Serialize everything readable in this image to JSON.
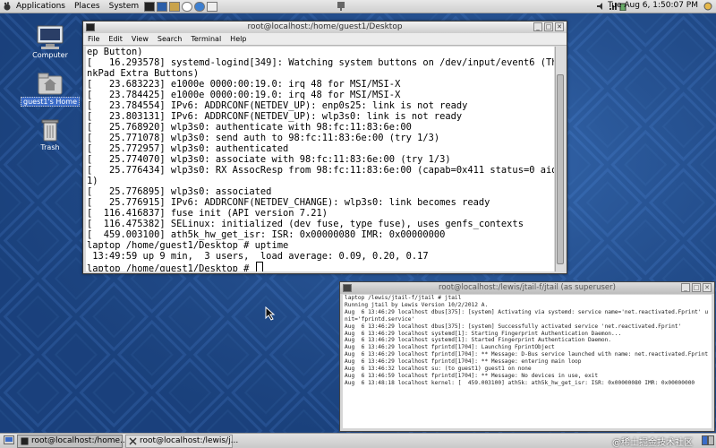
{
  "top_panel": {
    "menus": [
      "Applications",
      "Places",
      "System"
    ],
    "clock": "Tue Aug  6,  1:50:07 PM"
  },
  "desktop_icons": [
    {
      "label": "Computer",
      "icon": "computer-icon"
    },
    {
      "label": "guest1's Home",
      "icon": "home-folder-icon"
    },
    {
      "label": "Trash",
      "icon": "trash-icon"
    }
  ],
  "terminal1": {
    "title": "root@localhost:/home/guest1/Desktop",
    "menu": [
      "File",
      "Edit",
      "View",
      "Search",
      "Terminal",
      "Help"
    ],
    "lines": [
      "ep Button)",
      "[   16.293578] systemd-logind[349]: Watching system buttons on /dev/input/event6 (Thi",
      "nkPad Extra Buttons)",
      "[   23.683223] e1000e 0000:00:19.0: irq 48 for MSI/MSI-X",
      "[   23.784425] e1000e 0000:00:19.0: irq 48 for MSI/MSI-X",
      "[   23.784554] IPv6: ADDRCONF(NETDEV_UP): enp0s25: link is not ready",
      "[   23.803131] IPv6: ADDRCONF(NETDEV_UP): wlp3s0: link is not ready",
      "[   25.768920] wlp3s0: authenticate with 98:fc:11:83:6e:00",
      "[   25.771078] wlp3s0: send auth to 98:fc:11:83:6e:00 (try 1/3)",
      "[   25.772957] wlp3s0: authenticated",
      "[   25.774070] wlp3s0: associate with 98:fc:11:83:6e:00 (try 1/3)",
      "[   25.776434] wlp3s0: RX AssocResp from 98:fc:11:83:6e:00 (capab=0x411 status=0 aid=",
      "1)",
      "[   25.776895] wlp3s0: associated",
      "[   25.776915] IPv6: ADDRCONF(NETDEV_CHANGE): wlp3s0: link becomes ready",
      "[  116.416837] fuse init (API version 7.21)",
      "[  116.475382] SELinux: initialized (dev fuse, type fuse), uses genfs_contexts",
      "[  459.003100] ath5k_hw_get_isr: ISR: 0x00000080 IMR: 0x00000000",
      "laptop /home/guest1/Desktop # uptime",
      " 13:49:59 up 9 min,  3 users,  load average: 0.09, 0.20, 0.17"
    ],
    "prompt": "laptop /home/guest1/Desktop # "
  },
  "terminal2": {
    "title": "root@localhost:/lewis/jtail-f/jtail (as superuser)",
    "lines": [
      "laptop /lewis/jtail-f/jtail # jtail",
      "Running jtail by Lewis Version 10/2/2012 A.",
      "Aug  6 13:46:29 localhost dbus[375]: [system] Activating via systemd: service name='net.reactivated.Fprint' u",
      "nit='fprintd.service'",
      "Aug  6 13:46:29 localhost dbus[375]: [system] Successfully activated service 'net.reactivated.Fprint'",
      "Aug  6 13:46:29 localhost systemd[1]: Starting Fingerprint Authentication Daemon...",
      "Aug  6 13:46:29 localhost systemd[1]: Started Fingerprint Authentication Daemon.",
      "Aug  6 13:46:29 localhost fprintd[1704]: Launching FprintObject",
      "Aug  6 13:46:29 localhost fprintd[1704]: ** Message: D-Bus service launched with name: net.reactivated.Fprint",
      "Aug  6 13:46:29 localhost fprintd[1704]: ** Message: entering main loop",
      "Aug  6 13:46:32 localhost su: (to guest1) guest1 on none",
      "Aug  6 13:46:59 localhost fprintd[1704]: ** Message: No devices in use, exit",
      "Aug  6 13:48:18 localhost kernel: [  459.003100] ath5k: ath5k_hw_get_isr: ISR: 0x00000080 IMR: 0x00000000"
    ]
  },
  "taskbar": {
    "items": [
      {
        "label": "root@localhost:/home...",
        "active": true
      },
      {
        "label": "root@localhost:/lewis/j...",
        "active": false
      }
    ],
    "watermark": "@稀土掘金技术社区"
  },
  "colors": {
    "desktop": "#1f4a8a",
    "desktop_light": "#3a6db8",
    "panel": "#d4d4d4",
    "selection": "#3b6cc8"
  }
}
